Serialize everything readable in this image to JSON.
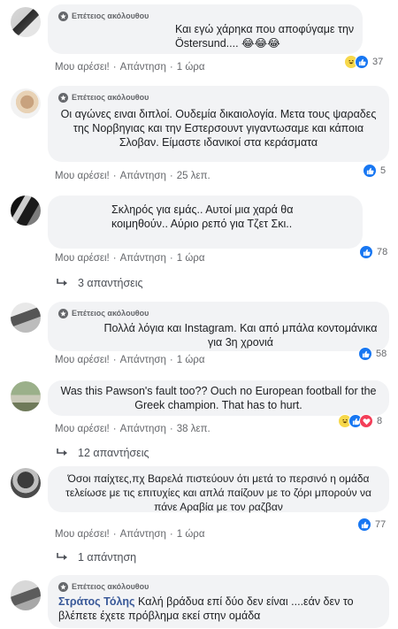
{
  "colors": {
    "link": "#385898",
    "muted": "#65676b",
    "bubble": "#f2f3f5",
    "like": "#1877f2"
  },
  "icons": {
    "badge": "star-badge-icon",
    "like": "like-icon",
    "haha": "haha-icon",
    "love": "love-icon",
    "reply_arrow": "reply-arrow-icon"
  },
  "actions": {
    "like": "Μου αρέσει!",
    "reply": "Απάντηση",
    "sep": "·"
  },
  "badge": "Επέτειος ακόλουθου",
  "comments": [
    {
      "text": "Και εγώ χάρηκα που αποφύγαμε την Östersund.... 😂😂😂",
      "time": "1 ώρα",
      "reactions": "37"
    },
    {
      "text": "Οι αγώνες ειναι διπλοί. Ουδεμία δικαιολογία. Μετα τους ψαραδες της Νορβηγιας και την Εστερσουντ γιγαντωσαμε και κάποια Σλοβαν. Είμαστε ιδανικοί στα κεράσματα",
      "time": "25 λεπ.",
      "reactions": "5"
    },
    {
      "text": "Σκληρός για εμάς.. Αυτοί μια χαρά θα κοιμηθούν.. Αύριο ρεπό για Τζετ Σκι..",
      "time": "1 ώρα",
      "reactions": "78",
      "replies": "3 απαντήσεις"
    },
    {
      "text": "Πολλά λόγια και Instagram. Και από μπάλα κοντομάνικα για 3η χρονιά",
      "time": "1 ώρα",
      "reactions": "58"
    },
    {
      "text": "Was this Pawson's fault too?? Ouch no European football for the Greek champion. That has to hurt.",
      "time": "38 λεπ.",
      "reactions": "8",
      "replies": "12 απαντήσεις"
    },
    {
      "text": "Όσοι παίχτες,πχ Βαρελά πιστεύουν ότι μετά το περσινό η ομάδα τελείωσε με τις επιτυχίες και απλά παίζουν με το ζόρι μπορούν να πάνε Αραβία με τον ραζβαν",
      "time": "1 ώρα",
      "reactions": "77",
      "replies": "1 απάντηση"
    },
    {
      "author": "Στράτος Τόλης",
      "text": "Καλή βράδυα επί δύο δεν είναι ....εάν δεν το βλέπετε έχετε πρόβλημα εκεί στην ομάδα"
    }
  ]
}
